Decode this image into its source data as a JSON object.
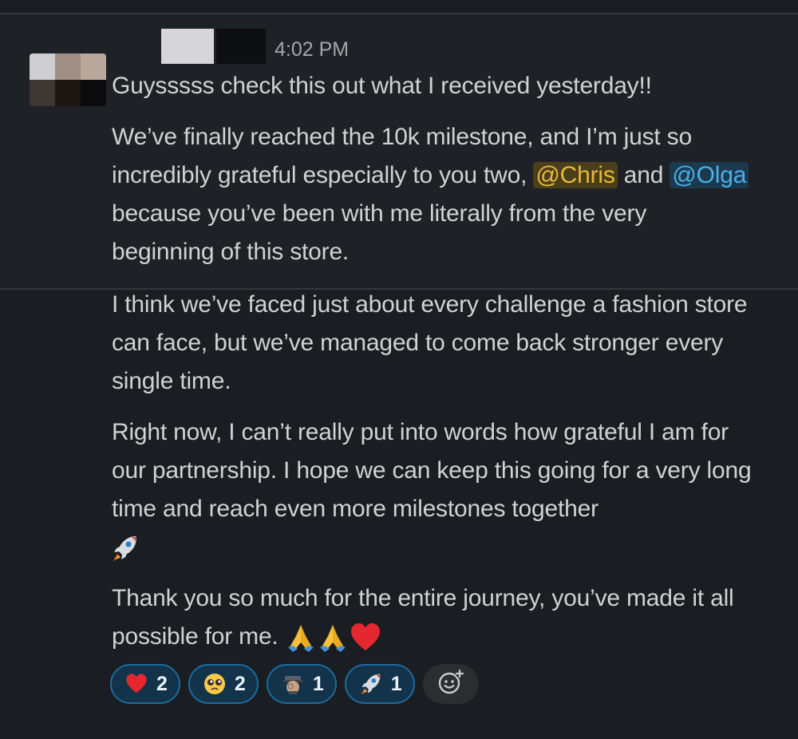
{
  "message": {
    "timestamp": "4:02 PM",
    "para1": "Guysssss check this out what I received yesterday!!",
    "para2": {
      "part1": "We’ve finally reached the 10k milestone, and I’m just so incredibly grateful especially to you two,",
      "mention1": "@Chris",
      "part2": "and",
      "mention2": "@Olga",
      "part3": "because you’ve been with me literally from the very beginning of this store."
    },
    "para3": "I think we’ve faced just about every challenge a fashion store can face, but we’ve managed to come back stronger every single time.",
    "para4": "Right now, I can’t really put into words how grateful I am for our partnership. I hope we can keep this going for a very long time and reach even more milestones together",
    "para5": "Thank you so much for the entire journey, you’ve made it all possible for me."
  },
  "reactions": [
    {
      "icon": "heart-icon",
      "count": "2"
    },
    {
      "icon": "pleading-face-icon",
      "count": "2"
    },
    {
      "icon": "detective-icon",
      "count": "1"
    },
    {
      "icon": "rocket-icon",
      "count": "1"
    }
  ],
  "colors": {
    "background": "#1a1d21",
    "text": "#d1d2d3",
    "mention_chris": "#e8b83b",
    "mention_olga": "#4ab0e6",
    "reaction_bg": "#12334a",
    "reaction_border": "#1d6aa0"
  }
}
